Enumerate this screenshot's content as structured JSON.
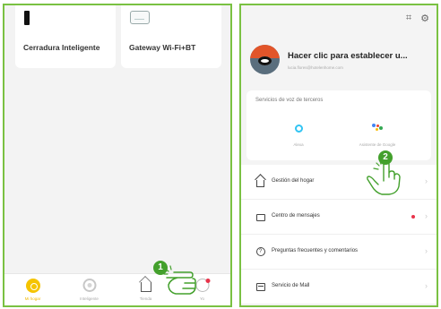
{
  "left_screen": {
    "devices": [
      {
        "name": "Cerradura Inteligente",
        "icon": "smart-lock-icon"
      },
      {
        "name": "Gateway Wi-Fi+BT",
        "icon": "gateway-icon"
      }
    ],
    "tabs": [
      {
        "label": "Mi hogar",
        "icon": "home-tab-icon",
        "active": true
      },
      {
        "label": "Inteligente",
        "icon": "scene-tab-icon",
        "active": false
      },
      {
        "label": "Tienda",
        "icon": "shop-tab-icon",
        "active": false
      },
      {
        "label": "Yo",
        "icon": "me-tab-icon",
        "active": false,
        "badge": true
      }
    ],
    "step_number": "1"
  },
  "right_screen": {
    "top_icons": [
      "scan-icon",
      "settings-icon"
    ],
    "top_icon_glyphs": [
      "⌗",
      "⚙"
    ],
    "profile": {
      "name": "Hacer clic para establecer u...",
      "email": "lucia.flores@hotelenhome.com"
    },
    "voice_services": {
      "title": "Servicios de voz de terceros",
      "items": [
        {
          "label": "Alexa",
          "icon": "alexa-icon"
        },
        {
          "label": "Asistente de Google",
          "icon": "google-assistant-icon"
        }
      ]
    },
    "menu": [
      {
        "label": "Gestión del hogar",
        "icon": "home-manage-icon",
        "dot": false
      },
      {
        "label": "Centro de mensajes",
        "icon": "message-center-icon",
        "dot": true
      },
      {
        "label": "Preguntas frecuentes y comentarios",
        "icon": "faq-icon",
        "dot": false
      },
      {
        "label": "Servicio de Mall",
        "icon": "mall-service-icon",
        "dot": false
      }
    ],
    "step_number": "2"
  },
  "colors": {
    "frame_green": "#7ac142",
    "badge_green": "#43a02c",
    "active_tab": "#f0b800",
    "alert_red": "#e8334a"
  }
}
